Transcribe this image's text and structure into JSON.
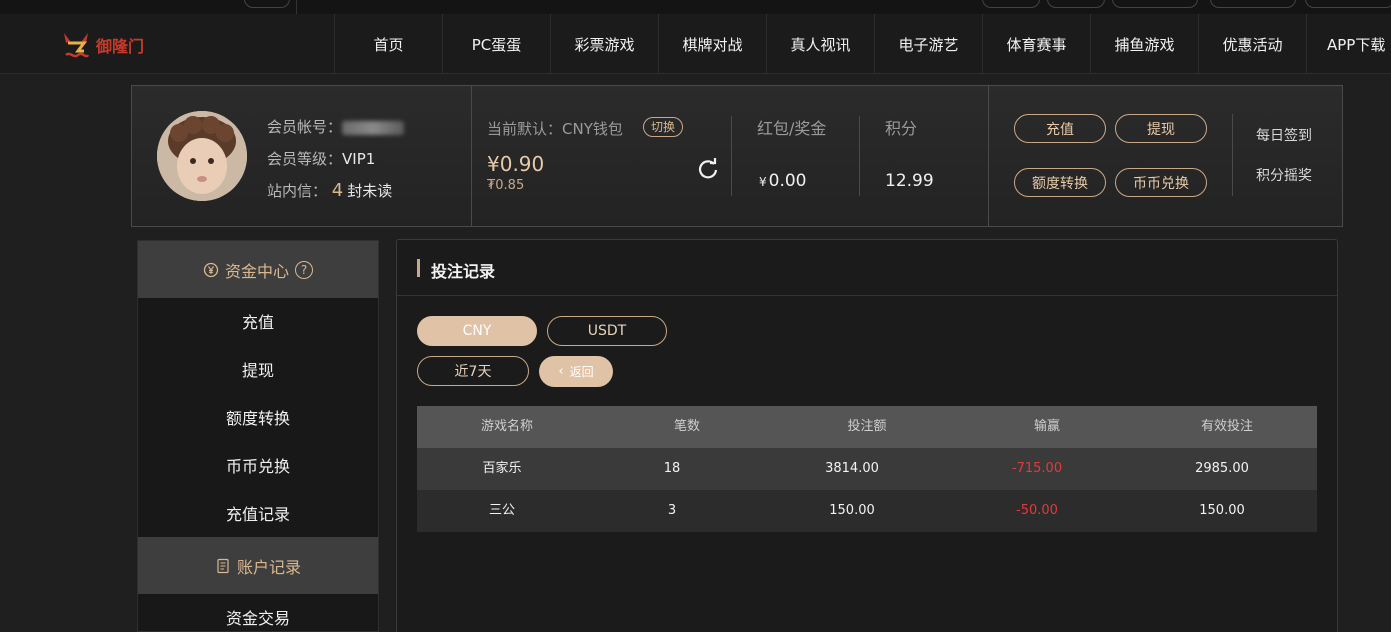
{
  "nav": {
    "logo_text": "御隆门",
    "items": [
      "首页",
      "PC蛋蛋",
      "彩票游戏",
      "棋牌对战",
      "真人视讯",
      "电子游艺",
      "体育赛事",
      "捕鱼游戏",
      "优惠活动",
      "APP下载"
    ]
  },
  "member": {
    "account_label": "会员帐号：",
    "level_label": "会员等级：",
    "level_value": "VIP1",
    "mail_label": "站内信：",
    "mail_count": "4",
    "mail_unread": "封未读",
    "wallet_label": "当前默认：CNY钱包",
    "switch_label": "切换",
    "balance": "¥0.90",
    "balance_sub": "₮0.85",
    "bonus_label": "红包/奖金",
    "bonus_currency": "¥",
    "bonus_value": "0.00",
    "points_label": "积分",
    "points_value": "12.99",
    "actions": [
      "充值",
      "提现",
      "额度转换",
      "币币兑换"
    ],
    "daily_checkin": "每日签到",
    "points_lottery": "积分摇奖"
  },
  "sidebar": {
    "fund_center": "资金中心",
    "fund_items": [
      "充值",
      "提现",
      "额度转换",
      "币币兑换",
      "充值记录"
    ],
    "account_records": "账户记录",
    "account_items": [
      "资金交易"
    ]
  },
  "main": {
    "title": "投注记录",
    "currency_tabs": [
      "CNY",
      "USDT"
    ],
    "range_label": "近7天",
    "back_label": "返回",
    "columns": [
      "游戏名称",
      "笔数",
      "投注额",
      "输赢",
      "有效投注"
    ],
    "rows": [
      {
        "game": "百家乐",
        "count": "18",
        "bet": "3814.00",
        "winloss": "-715.00",
        "valid": "2985.00"
      },
      {
        "game": "三公",
        "count": "3",
        "bet": "150.00",
        "winloss": "-50.00",
        "valid": "150.00"
      }
    ]
  },
  "colors": {
    "accent": "#e0c2a6",
    "accent_border": "#c9a888",
    "loss": "#e03a3a",
    "background": "#1f1f1f"
  }
}
